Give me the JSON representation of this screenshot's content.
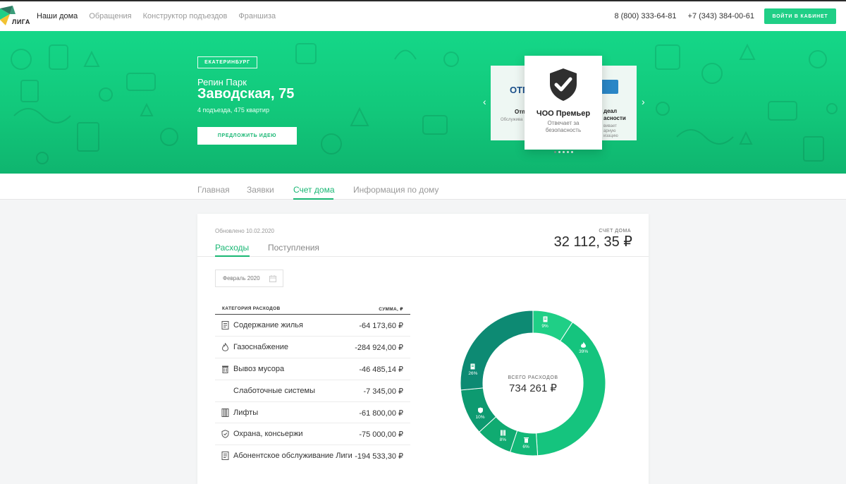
{
  "brand": {
    "name": "ЛИГА",
    "colors": {
      "accent": "#1fcf86",
      "accent_dark": "#19b774",
      "teal": "#0d8a73"
    }
  },
  "nav": {
    "items": [
      {
        "label": "Наши дома",
        "active": true
      },
      {
        "label": "Обращения",
        "active": false
      },
      {
        "label": "Конструктор подъездов",
        "active": false
      },
      {
        "label": "Франшиза",
        "active": false
      }
    ],
    "phones": [
      "8 (800) 333-64-81",
      "+7 (343) 384-00-61"
    ],
    "login_label": "ВОЙТИ В КАБИНЕТ"
  },
  "hero": {
    "city": "ЕКАТЕРИНБУРГ",
    "complex": "Репин Парк",
    "address": "Заводская, 75",
    "meta": "4 подъезда, 475 квартир",
    "idea_button": "ПРЕДЛОЖИТЬ ИДЕЮ",
    "carousel": {
      "prev_icon": "chevron-left-icon",
      "next_icon": "chevron-right-icon",
      "left_card": {
        "logo": "ОТП",
        "title": "Отп",
        "desc": "Обслужива"
      },
      "main_card": {
        "icon": "shield-check-icon",
        "title": "ЧОО Премьер",
        "desc": "Отвечает за безопасность"
      },
      "right_card": {
        "title_line1": "деал",
        "title_line2": "асности",
        "desc_line1": "вивает",
        "desc_line2": "арную",
        "desc_line3": "изацию"
      },
      "dots_total": 5,
      "dot_active": 0
    }
  },
  "tabs": [
    {
      "label": "Главная",
      "active": false
    },
    {
      "label": "Заявки",
      "active": false
    },
    {
      "label": "Счет дома",
      "active": true
    },
    {
      "label": "Информация по дому",
      "active": false
    }
  ],
  "account": {
    "updated": "Обновлено 10.02.2020",
    "subtabs": [
      {
        "label": "Расходы",
        "active": true
      },
      {
        "label": "Поступления",
        "active": false
      }
    ],
    "balance_label": "СЧЕТ ДОМА",
    "balance_value": "32 112, 35 ₽",
    "date_value": "Февраль 2020"
  },
  "expenses": {
    "header_category": "КАТЕГОРИЯ РАСХОДОВ",
    "header_sum": "СУММА, ₽",
    "rows": [
      {
        "icon": "document-icon",
        "name": "Содержание жилья",
        "amount": "-64 173,60 ₽"
      },
      {
        "icon": "flame-icon",
        "name": "Газоснабжение",
        "amount": "-284 924,00 ₽"
      },
      {
        "icon": "trash-icon",
        "name": "Вывоз мусора",
        "amount": "-46 485,14 ₽"
      },
      {
        "icon": "",
        "name": "Слаботочные системы",
        "amount": "-7 345,00 ₽"
      },
      {
        "icon": "elevator-icon",
        "name": "Лифты",
        "amount": "-61 800,00 ₽"
      },
      {
        "icon": "shield-icon",
        "name": "Охрана, консьержи",
        "amount": "-75 000,00 ₽"
      },
      {
        "icon": "document-icon",
        "name": "Абонентское обслуживание Лиги",
        "amount": "-194 533,30 ₽"
      }
    ]
  },
  "chart_data": {
    "type": "pie",
    "donut": true,
    "center_label": "ВСЕГО РАСХОДОВ",
    "center_value": "734 261 ₽",
    "slices": [
      {
        "label": "9%",
        "value": 9,
        "icon": "document-icon",
        "color": "#1fcf86"
      },
      {
        "label": "39%",
        "value": 39,
        "icon": "flame-icon",
        "color": "#15c47e"
      },
      {
        "label": "6%",
        "value": 6,
        "icon": "trash-icon",
        "color": "#12b877"
      },
      {
        "label": "8%",
        "value": 8,
        "icon": "elevator-icon",
        "color": "#10ab71"
      },
      {
        "label": "10%",
        "value": 10,
        "icon": "shield-icon",
        "color": "#0d9a70"
      },
      {
        "label": "26%",
        "value": 26,
        "icon": "document-icon",
        "color": "#0d8a73"
      }
    ]
  }
}
